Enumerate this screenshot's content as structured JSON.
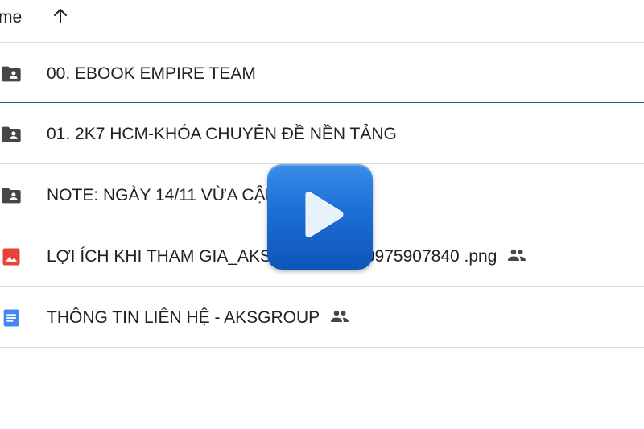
{
  "header": {
    "column_label": "me",
    "sort_icon": "arrow-up-icon"
  },
  "files": [
    {
      "name": "00. EBOOK EMPIRE TEAM",
      "type": "shared-folder",
      "icon": "shared-folder-icon",
      "selected": true,
      "shared": false
    },
    {
      "name": "01. 2K7 HCM-KHÓA CHUYÊN ĐỀ NỀN TẢNG",
      "type": "shared-folder",
      "icon": "shared-folder-icon",
      "selected": false,
      "shared": false
    },
    {
      "name": "NOTE: NGÀY 14/11 VỪA CẬP",
      "type": "shared-folder",
      "icon": "shared-folder-icon",
      "selected": false,
      "shared": false
    },
    {
      "name": "LỢI ÍCH KHI THAM GIA_AKS",
      "name_tail": "LO 0975907840 .png",
      "type": "image",
      "icon": "image-file-icon",
      "selected": false,
      "shared": true
    },
    {
      "name": "THÔNG TIN LIÊN HỆ - AKSGROUP",
      "type": "document",
      "icon": "document-file-icon",
      "selected": false,
      "shared": true
    }
  ],
  "overlay": {
    "icon": "play-icon"
  },
  "colors": {
    "selection_border": "#1a56b8",
    "folder_icon": "#444746",
    "image_icon": "#ea4335",
    "doc_icon": "#4285f4",
    "play_button": "#1c6ed6"
  }
}
